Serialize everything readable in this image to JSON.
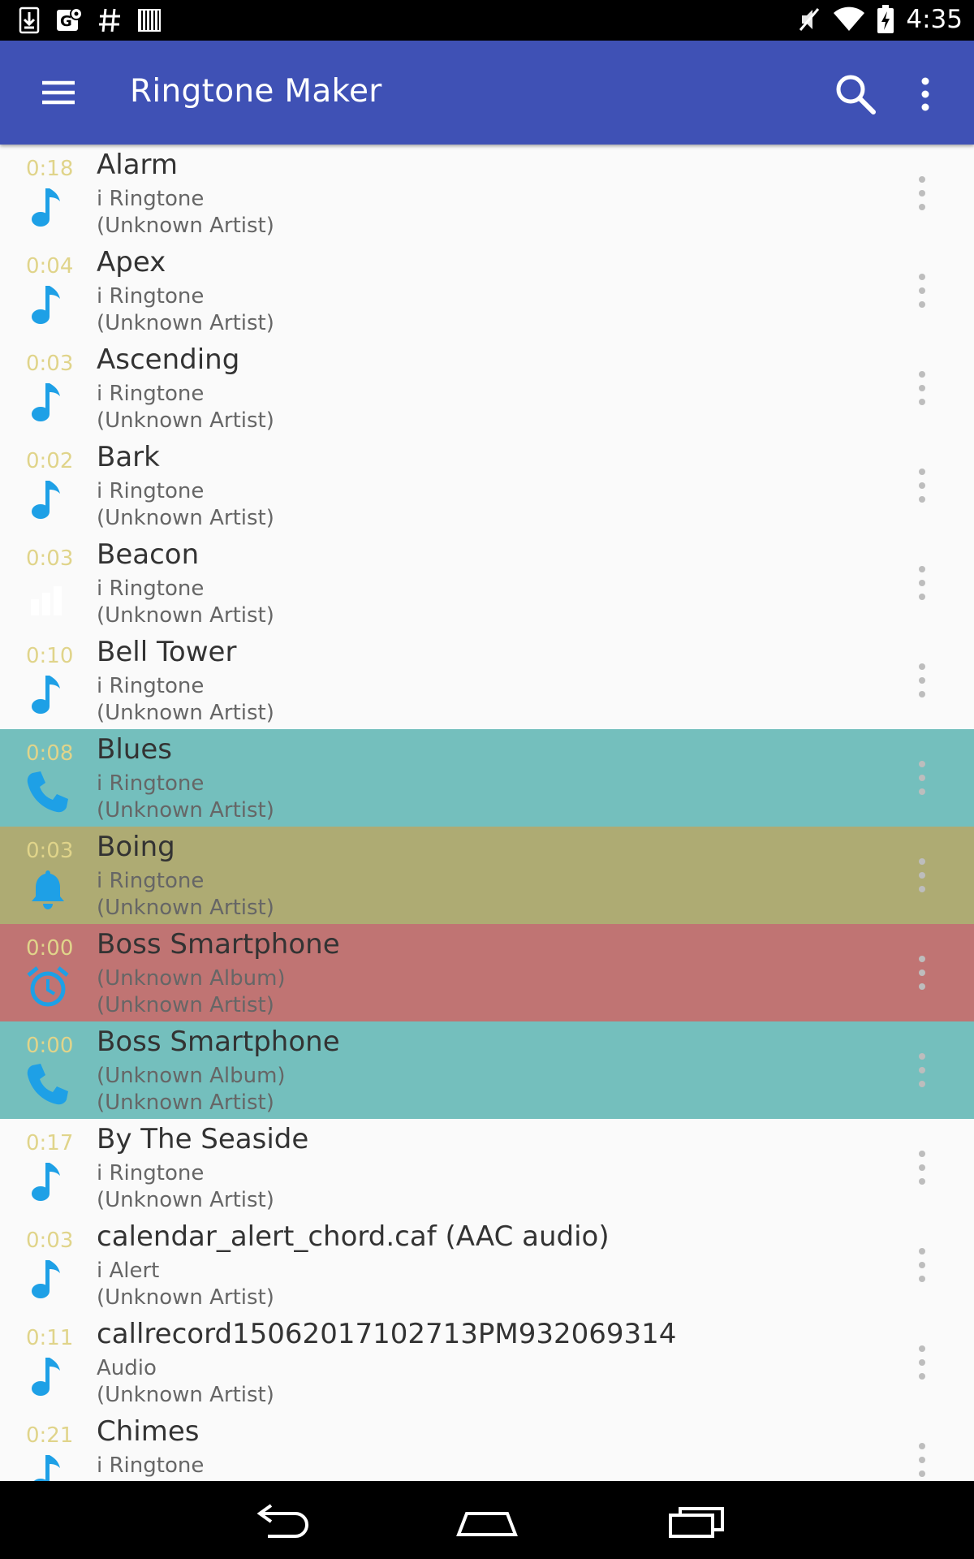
{
  "status_bar": {
    "time": "4:35",
    "left_icons": [
      "download-icon",
      "gmail-maps-icon",
      "hash-icon",
      "barcode-icon"
    ],
    "right_icons": [
      "mute-icon",
      "wifi-icon",
      "battery-charging-icon"
    ]
  },
  "toolbar": {
    "title": "Ringtone Maker",
    "background": "#3f51b5",
    "icons": [
      "menu-icon",
      "search-icon",
      "overflow-menu-icon"
    ]
  },
  "colors": {
    "ringtone": "#74bfbd",
    "notification": "#aeab73",
    "alarm": "#c07473",
    "icon_blue": "#1ea0e6",
    "duration": "#e0d48a"
  },
  "rows": [
    {
      "duration": "0:18",
      "title": "Alarm",
      "album": "i Ringtone",
      "artist": "(Unknown Artist)",
      "type": "music",
      "bg": "none"
    },
    {
      "duration": "0:04",
      "title": "Apex",
      "album": "i Ringtone",
      "artist": "(Unknown Artist)",
      "type": "music",
      "bg": "none"
    },
    {
      "duration": "0:03",
      "title": "Ascending",
      "album": "i Ringtone",
      "artist": "(Unknown Artist)",
      "type": "music",
      "bg": "none"
    },
    {
      "duration": "0:02",
      "title": "Bark",
      "album": "i Ringtone",
      "artist": "(Unknown Artist)",
      "type": "music",
      "bg": "none"
    },
    {
      "duration": "0:03",
      "title": "Beacon",
      "album": "i Ringtone",
      "artist": "(Unknown Artist)",
      "type": "bars",
      "bg": "none"
    },
    {
      "duration": "0:10",
      "title": "Bell Tower",
      "album": "i Ringtone",
      "artist": "(Unknown Artist)",
      "type": "music",
      "bg": "none"
    },
    {
      "duration": "0:08",
      "title": "Blues",
      "album": "i Ringtone",
      "artist": "(Unknown Artist)",
      "type": "phone",
      "bg": "ringtone"
    },
    {
      "duration": "0:03",
      "title": "Boing",
      "album": "i Ringtone",
      "artist": "(Unknown Artist)",
      "type": "bell",
      "bg": "notification"
    },
    {
      "duration": "0:00",
      "title": "Boss Smartphone",
      "album": "(Unknown Album)",
      "artist": "(Unknown Artist)",
      "type": "alarm",
      "bg": "alarm"
    },
    {
      "duration": "0:00",
      "title": "Boss Smartphone",
      "album": "(Unknown Album)",
      "artist": "(Unknown Artist)",
      "type": "phone",
      "bg": "ringtone"
    },
    {
      "duration": "0:17",
      "title": "By The Seaside",
      "album": "i Ringtone",
      "artist": "(Unknown Artist)",
      "type": "music",
      "bg": "none"
    },
    {
      "duration": "0:03",
      "title": "calendar_alert_chord.caf (AAC audio)",
      "album": "i Alert",
      "artist": "(Unknown Artist)",
      "type": "music",
      "bg": "none"
    },
    {
      "duration": "0:11",
      "title": "callrecord15062017102713PM932069314",
      "album": "Audio",
      "artist": "(Unknown Artist)",
      "type": "music",
      "bg": "none"
    },
    {
      "duration": "0:21",
      "title": "Chimes",
      "album": "i Ringtone",
      "artist": "",
      "type": "music",
      "bg": "none"
    }
  ],
  "nav_bar": {
    "icons": [
      "back-icon",
      "home-icon",
      "recents-icon"
    ]
  }
}
